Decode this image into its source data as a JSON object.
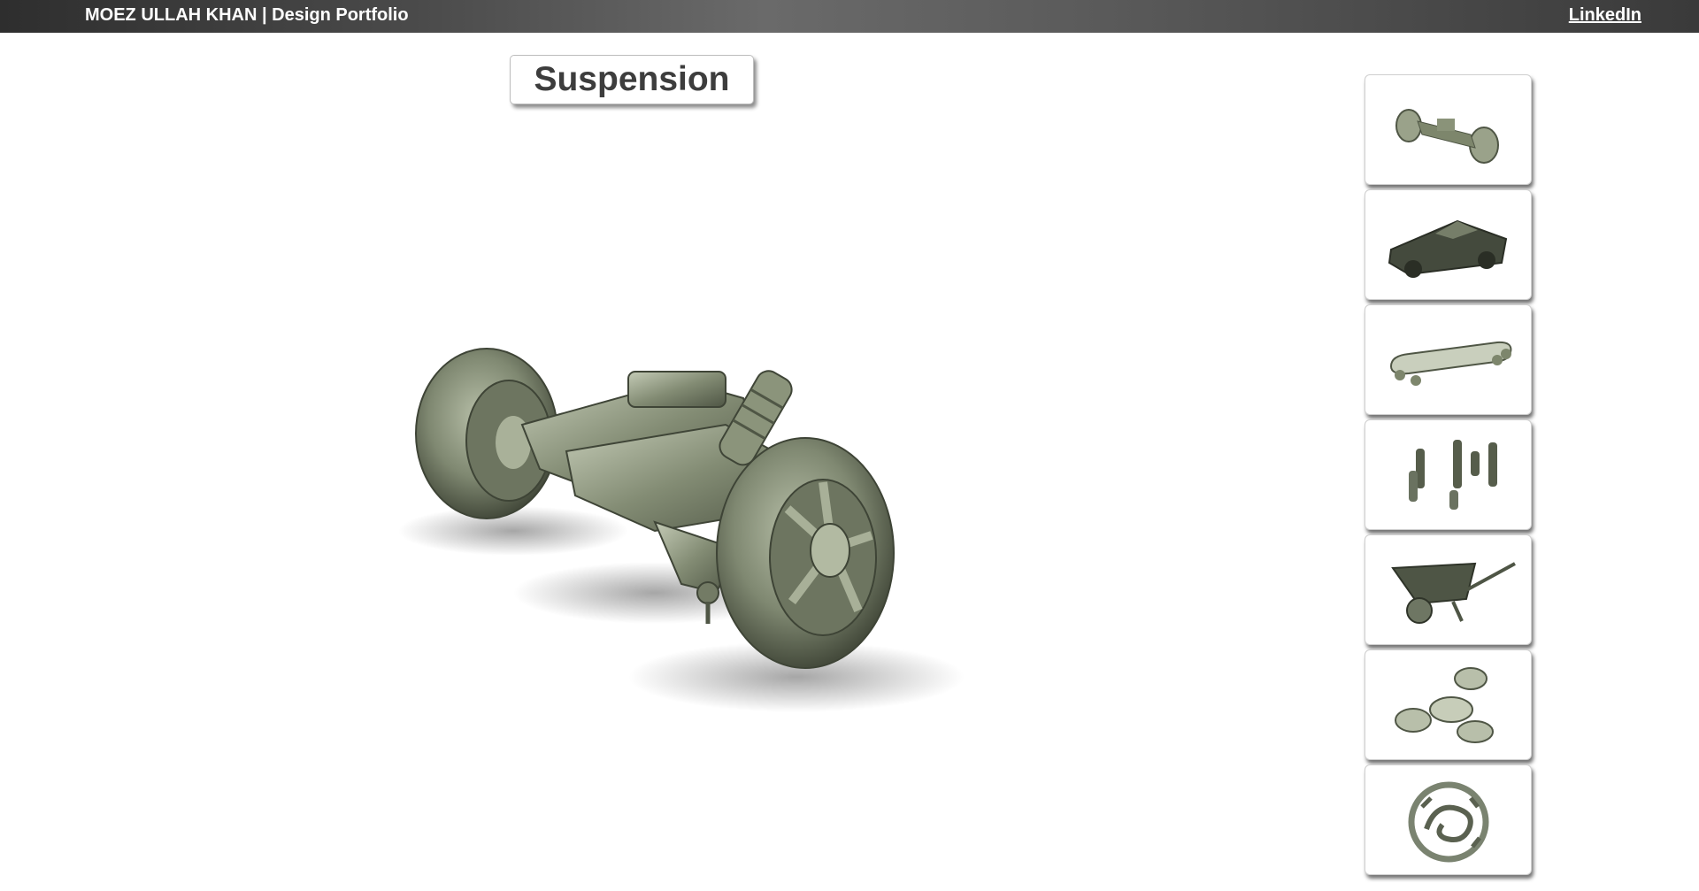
{
  "header": {
    "brand": "MOEZ ULLAH KHAN | Design Portfolio",
    "link_label": "LinkedIn"
  },
  "main": {
    "title": "Suspension",
    "model_icon": "suspension-3d-model"
  },
  "gallery": {
    "items": [
      {
        "icon": "suspension-thumbnail"
      },
      {
        "icon": "cybertruck-thumbnail"
      },
      {
        "icon": "skateboard-thumbnail"
      },
      {
        "icon": "chess-pieces-thumbnail"
      },
      {
        "icon": "wheelbarrow-thumbnail"
      },
      {
        "icon": "fidget-spinner-thumbnail"
      },
      {
        "icon": "dragon-emblem-thumbnail"
      }
    ]
  },
  "colors": {
    "metal": "#8e9780",
    "metal_dark": "#4f5645",
    "header_bg": "#4a4a4a"
  }
}
